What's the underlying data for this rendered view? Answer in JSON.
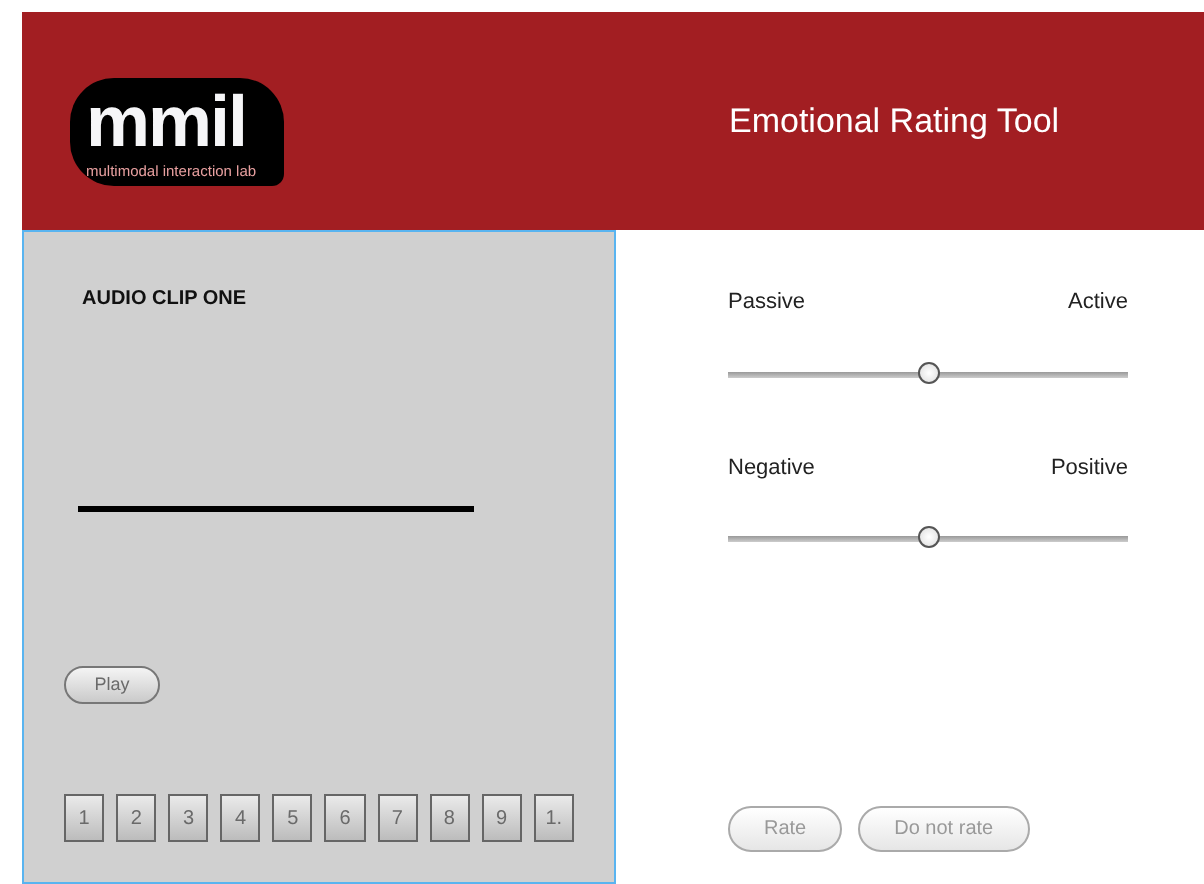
{
  "header": {
    "logo_text": "mmil",
    "logo_caption": "multimodal interaction lab",
    "title": "Emotional Rating Tool"
  },
  "clip": {
    "title": "AUDIO CLIP ONE",
    "play": {
      "label": "Play",
      "disabled": true
    },
    "numbers": [
      {
        "label": "1",
        "disabled": true
      },
      {
        "label": "2",
        "disabled": true
      },
      {
        "label": "3",
        "disabled": true
      },
      {
        "label": "4",
        "disabled": true
      },
      {
        "label": "5",
        "disabled": true
      },
      {
        "label": "6",
        "disabled": true
      },
      {
        "label": "7",
        "disabled": true
      },
      {
        "label": "8",
        "disabled": true
      },
      {
        "label": "9",
        "disabled": true
      },
      {
        "label": "1.",
        "disabled": true
      }
    ]
  },
  "scales": [
    {
      "left": "Passive",
      "right": "Active",
      "level": 0.5
    },
    {
      "left": "Negative",
      "right": "Positive",
      "level": 0.5
    }
  ],
  "buttons": [
    {
      "label": "Rate",
      "disabled": true
    },
    {
      "label": "Do not rate",
      "disabled": true
    }
  ]
}
